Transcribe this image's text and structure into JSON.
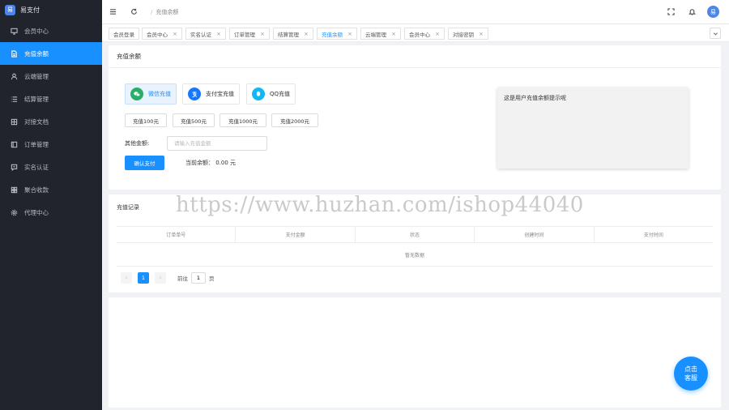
{
  "app": {
    "logo_glyph": "易",
    "name": "易支付"
  },
  "sidebar": {
    "items": [
      {
        "label": "会员中心",
        "icon": "monitor-icon",
        "active": false
      },
      {
        "label": "充值余额",
        "icon": "document-icon",
        "active": true
      },
      {
        "label": "云端管理",
        "icon": "user-icon",
        "active": false
      },
      {
        "label": "结算管理",
        "icon": "list-icon",
        "active": false
      },
      {
        "label": "对接文档",
        "icon": "book-icon",
        "active": false
      },
      {
        "label": "订单管理",
        "icon": "order-icon",
        "active": false
      },
      {
        "label": "实名认证",
        "icon": "message-icon",
        "active": false
      },
      {
        "label": "聚合收款",
        "icon": "grid-icon",
        "active": false
      },
      {
        "label": "代理中心",
        "icon": "gear-icon",
        "active": false
      }
    ]
  },
  "topbar": {
    "breadcrumb_sep": "/",
    "breadcrumb": "充值余额",
    "avatar": "易"
  },
  "tabs": [
    {
      "label": "会员登录",
      "closable": false,
      "active": false
    },
    {
      "label": "会员中心",
      "closable": true,
      "active": false
    },
    {
      "label": "实名认证",
      "closable": true,
      "active": false
    },
    {
      "label": "订单管理",
      "closable": true,
      "active": false
    },
    {
      "label": "结算管理",
      "closable": true,
      "active": false
    },
    {
      "label": "充值余额",
      "closable": true,
      "active": true
    },
    {
      "label": "云端管理",
      "closable": true,
      "active": false
    },
    {
      "label": "会员中心",
      "closable": true,
      "active": false
    },
    {
      "label": "对接密钥",
      "closable": true,
      "active": false
    }
  ],
  "tab_close_glyph": "×",
  "recharge": {
    "title": "充值余额",
    "methods": [
      {
        "label": "微信充值",
        "icon": "wechat-icon",
        "color": "#2aae67",
        "active": true
      },
      {
        "label": "支付宝充值",
        "icon": "alipay-icon",
        "color": "#1677ff",
        "active": false
      },
      {
        "label": "QQ充值",
        "icon": "qq-icon",
        "color": "#12b7f5",
        "active": false
      }
    ],
    "amounts": [
      "充值100元",
      "充值500元",
      "充值1000元",
      "充值2000元"
    ],
    "other_amount_label": "其他金额:",
    "other_amount_placeholder": "请输入充值金额",
    "confirm_label": "确认支付",
    "balance_text": "当前余额： 0.00 元",
    "notice": "这是用户充值余额提示呢"
  },
  "records": {
    "title": "充值记录",
    "columns": [
      "订单单号",
      "支付金额",
      "状态",
      "创建时间",
      "支付时间"
    ],
    "empty_text": "暂无数据",
    "pager": {
      "prev": "‹",
      "next": "›",
      "current_page": "1",
      "goto_label": "前往",
      "goto_value": "1",
      "page_unit": "页"
    }
  },
  "watermark": "https://www.huzhan.com/ishop44040",
  "fab": {
    "line1": "点击",
    "line2": "客服"
  },
  "colors": {
    "primary": "#1890ff",
    "sidebar_bg": "#21232d"
  }
}
